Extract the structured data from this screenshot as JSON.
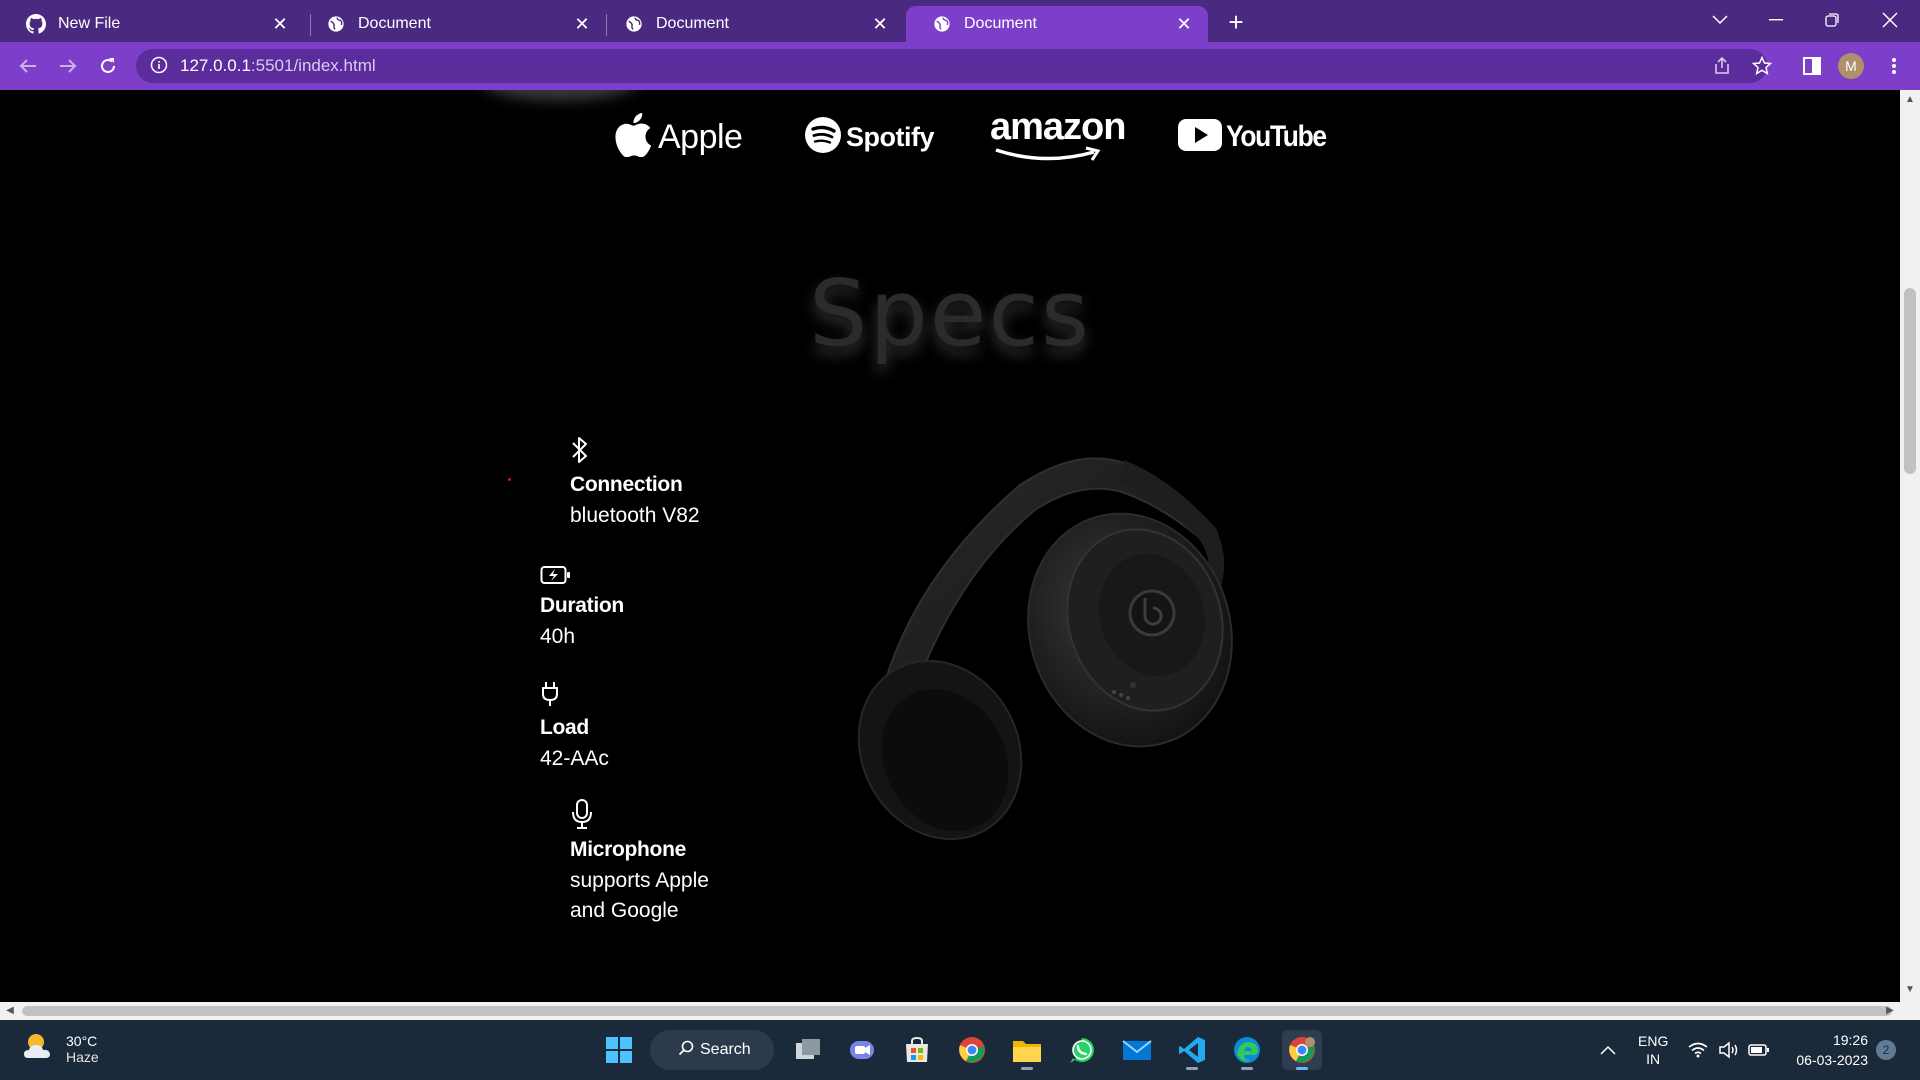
{
  "browser": {
    "tabs": [
      {
        "title": "New File",
        "icon": "github-icon",
        "active": false
      },
      {
        "title": "Document",
        "icon": "globe-icon",
        "active": false
      },
      {
        "title": "Document",
        "icon": "globe-icon",
        "active": false
      },
      {
        "title": "Document",
        "icon": "globe-icon",
        "active": true
      }
    ],
    "url_host": "127.0.0.1",
    "url_path": ":5501/index.html",
    "profile_initial": "M",
    "colors": {
      "tabbar": "#4a2a80",
      "toolbar": "#7d3fc9"
    }
  },
  "page": {
    "brands": [
      {
        "name": "Apple",
        "icon": "apple-logo-icon"
      },
      {
        "name": "Spotify",
        "icon": "spotify-logo-icon"
      },
      {
        "name": "amazon",
        "icon": "amazon-smile-icon"
      },
      {
        "name": "YouTube",
        "icon": "youtube-play-icon"
      }
    ],
    "specs_title": "Specs",
    "specs": [
      {
        "icon": "bluetooth-icon",
        "label": "Connection",
        "value": "bluetooth V82"
      },
      {
        "icon": "battery-charging-icon",
        "label": "Duration",
        "value": "40h"
      },
      {
        "icon": "plug-icon",
        "label": "Load",
        "value": "42-AAc"
      },
      {
        "icon": "microphone-icon",
        "label": "Microphone",
        "value": "supports Apple and Google"
      }
    ],
    "product_image": "black-headphones"
  },
  "taskbar": {
    "weather_temp": "30°C",
    "weather_cond": "Haze",
    "search_label": "Search",
    "apps": [
      "windows-start-icon",
      "task-view-icon",
      "teams-chat-icon",
      "microsoft-store-icon",
      "chrome-icon",
      "file-explorer-icon",
      "whatsapp-icon",
      "mail-icon",
      "vscode-icon",
      "edge-icon",
      "chrome-profile-icon"
    ],
    "lang_top": "ENG",
    "lang_bottom": "IN",
    "time": "19:26",
    "date": "06-03-2023",
    "notifications": "2"
  }
}
